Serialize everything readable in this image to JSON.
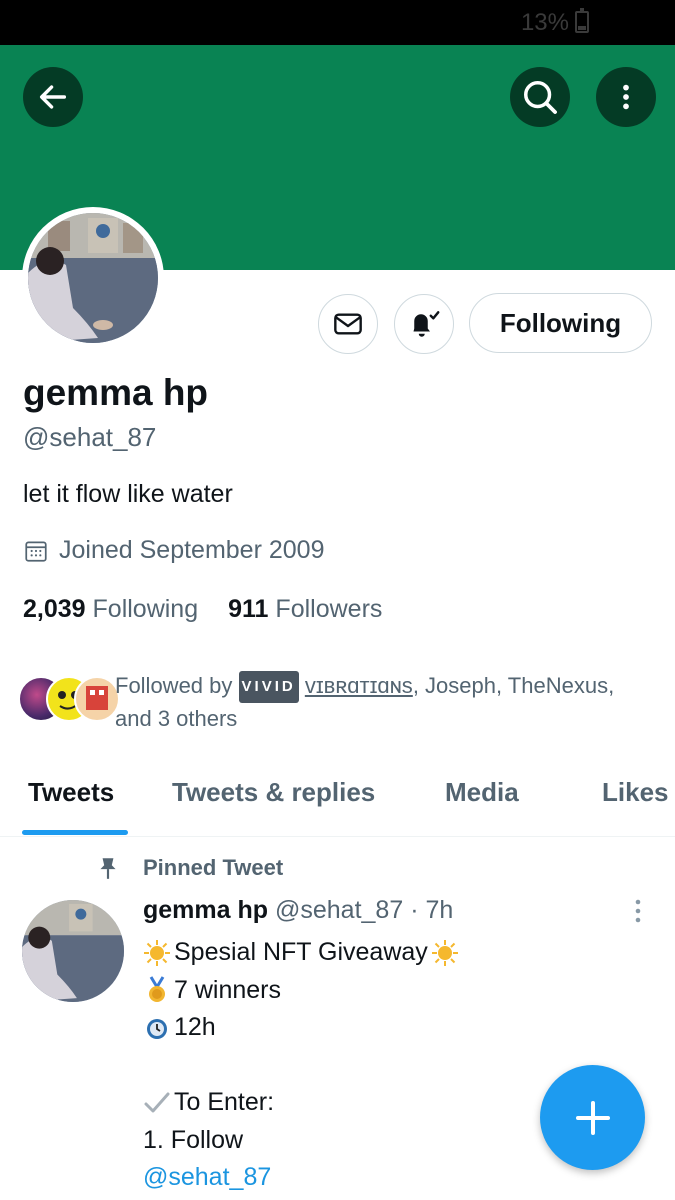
{
  "status_bar": {
    "battery": "13%"
  },
  "header": {
    "back_icon": "arrow-left-icon",
    "search_icon": "search-icon",
    "more_icon": "more-vertical-icon",
    "banner_color": "#098353"
  },
  "profile": {
    "name": "gemma hp",
    "handle": "@sehat_87",
    "bio": "let it flow like water",
    "joined": "Joined September 2009",
    "following_count": "2,039",
    "following_label": "Following",
    "followers_count": "911",
    "followers_label": "Followers",
    "follow_button": "Following",
    "followed_by": {
      "prefix": "Followed by",
      "badge": "VIVID",
      "vibrations": "vɪʙʀɑᴛɪɑɴs",
      "rest": ", Joseph, TheNexus, and 3 others"
    }
  },
  "tabs": [
    {
      "label": "Tweets"
    },
    {
      "label": "Tweets & replies"
    },
    {
      "label": "Media"
    },
    {
      "label": "Likes"
    }
  ],
  "pinned_tweet": {
    "pinned_label": "Pinned Tweet",
    "name": "gemma hp",
    "handle": "@sehat_87",
    "time": "· 7h",
    "lines": {
      "l1": "Spesial NFT Giveaway",
      "l2": "7 winners",
      "l3": "12h",
      "l4": "To Enter:",
      "l5": "1. Follow",
      "l6": "@sehat_87"
    }
  },
  "fab": {
    "icon": "plus-icon"
  },
  "colors": {
    "accent": "#1d9bf0",
    "secondary_text": "#536471",
    "banner": "#098353"
  }
}
